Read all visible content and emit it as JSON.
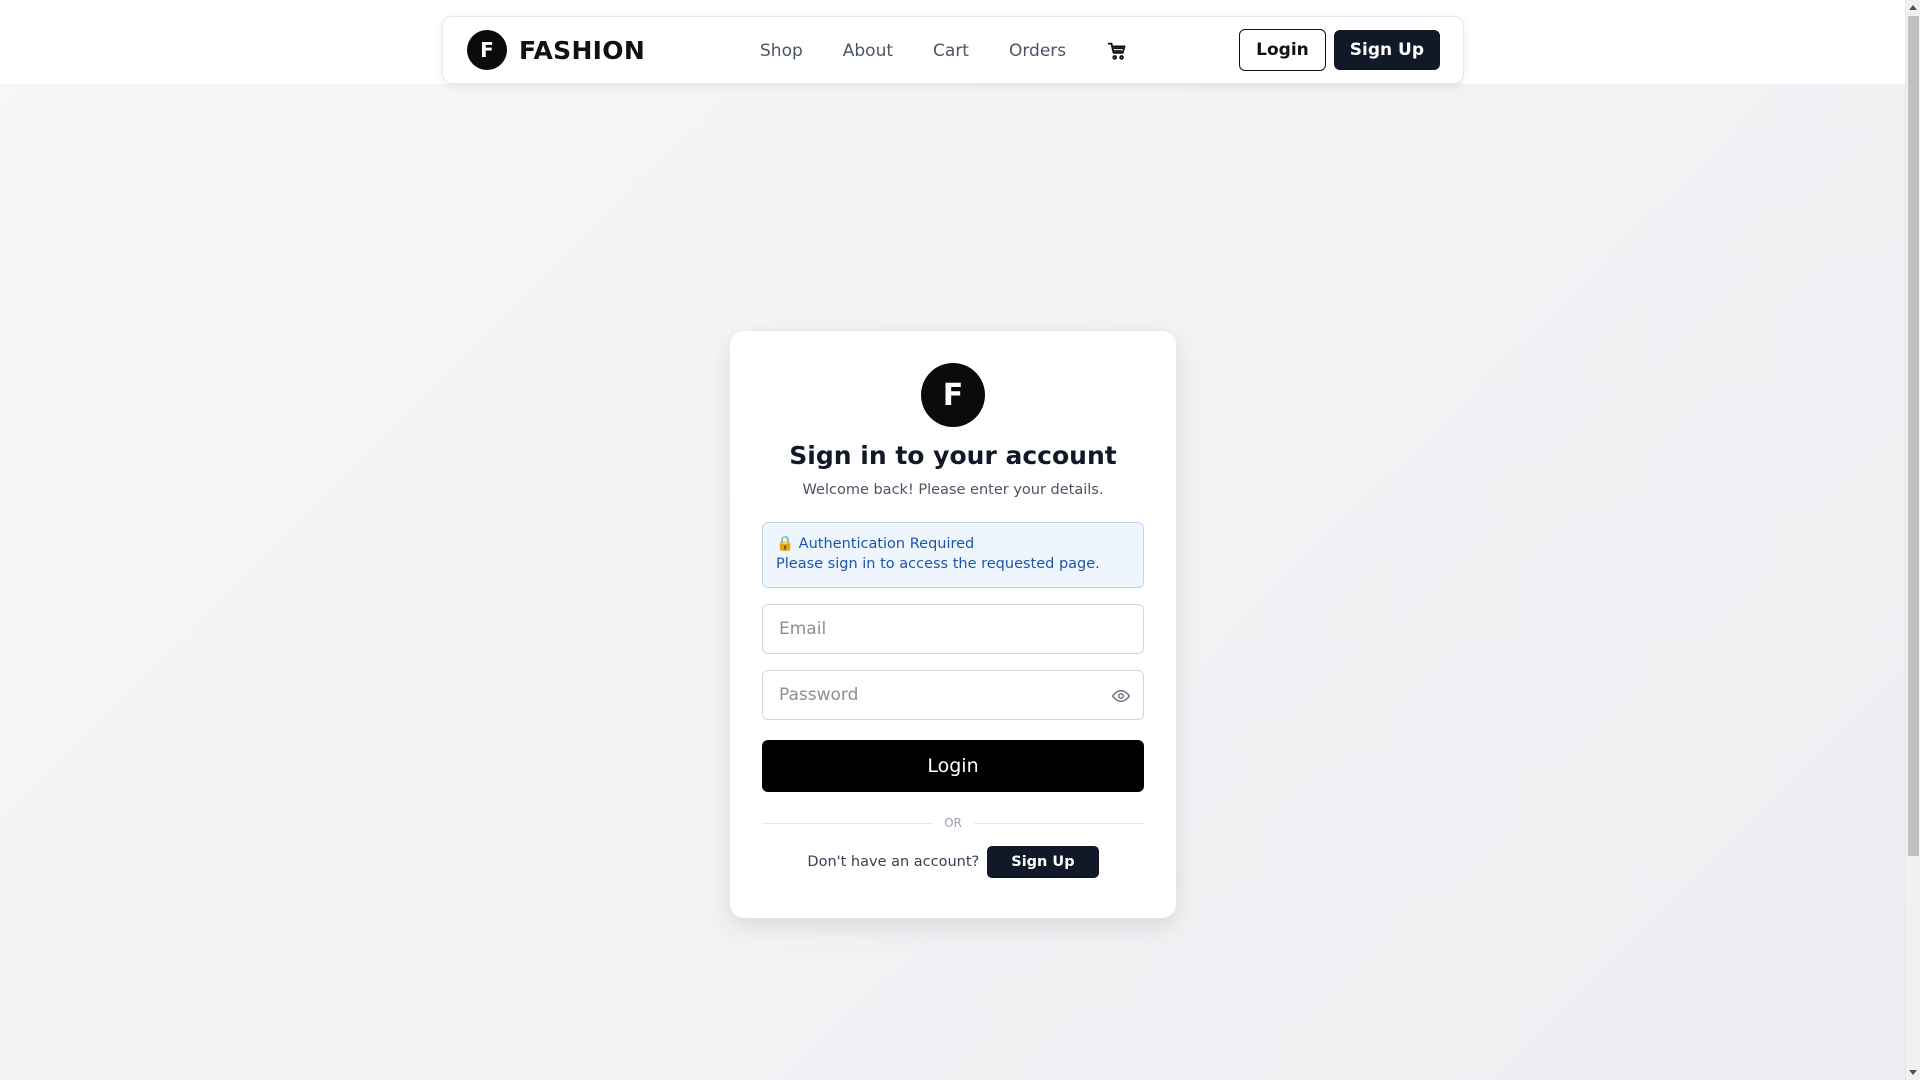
{
  "brand": {
    "logo_letter": "F",
    "name": "FASHION"
  },
  "nav": {
    "links": [
      "Shop",
      "About",
      "Cart",
      "Orders"
    ],
    "cart_icon": "cart-icon",
    "login_label": "Login",
    "signup_label": "Sign Up"
  },
  "card": {
    "logo_letter": "F",
    "title": "Sign in to your account",
    "subtitle": "Welcome back! Please enter your details.",
    "alert": {
      "icon": "🔒",
      "title": "Authentication Required",
      "message": "Please sign in to access the requested page."
    },
    "email_placeholder": "Email",
    "password_placeholder": "Password",
    "password_toggle_icon": "eye-icon",
    "login_label": "Login",
    "divider_text": "OR",
    "signup_prompt": "Don't have an account?",
    "signup_label": "Sign Up"
  },
  "colors": {
    "primary_dark": "#111827",
    "black": "#000000",
    "alert_bg": "#eef5fd",
    "alert_text": "#1e55a8"
  }
}
